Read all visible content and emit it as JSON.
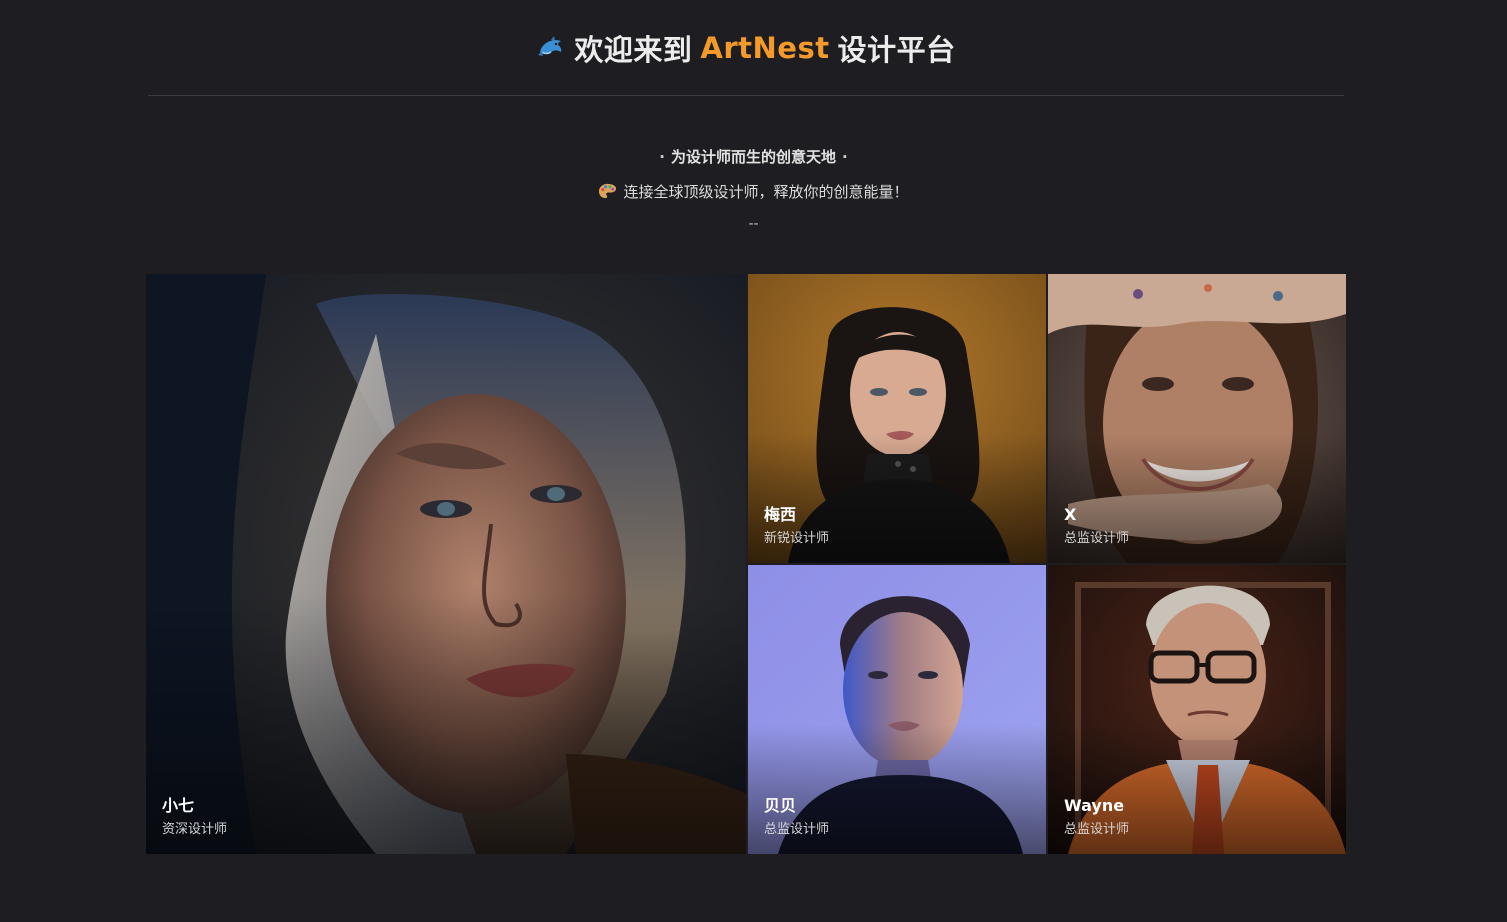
{
  "header": {
    "title_prefix": "欢迎来到",
    "brand": "ArtNest",
    "title_suffix": "设计平台",
    "icon": "dolphin-icon",
    "brand_color": "#f39a2b"
  },
  "intro": {
    "tagline": "为设计师而生的创意天地",
    "tagline_dot": "·",
    "subline": "连接全球顶级设计师，释放你的创意能量！",
    "subline_icon": "palette-icon",
    "divider": "--"
  },
  "designers": [
    {
      "name": "小七",
      "role": "资深设计师"
    },
    {
      "name": "梅西",
      "role": "新锐设计师"
    },
    {
      "name": "X",
      "role": "总监设计师"
    },
    {
      "name": "贝贝",
      "role": "总监设计师"
    },
    {
      "name": "Wayne",
      "role": "总监设计师"
    }
  ]
}
